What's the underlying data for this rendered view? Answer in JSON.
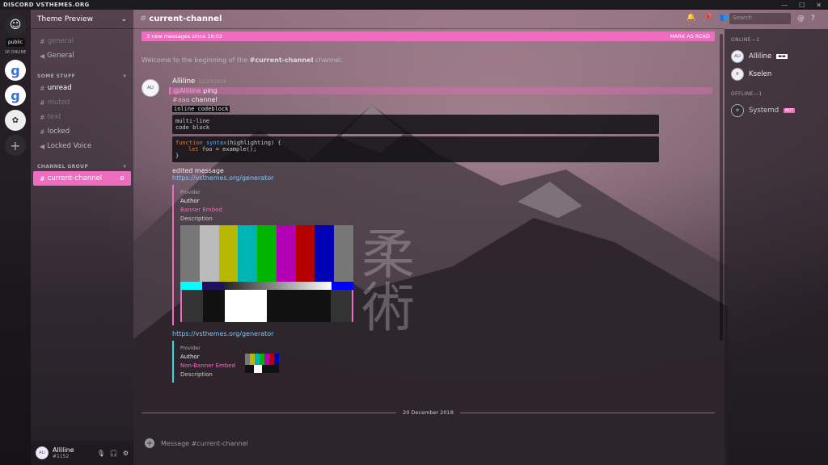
{
  "window": {
    "title": "DISCORD VSTHEMES.ORG",
    "controls": [
      "—",
      "☐",
      "✕"
    ]
  },
  "guilds": {
    "public_label": "public",
    "online_label": "16 ONLINE",
    "add_label": "+"
  },
  "server": {
    "name": "Theme Preview"
  },
  "channels": [
    {
      "name": "general",
      "kind": "text",
      "state": "muted"
    },
    {
      "name": "General",
      "kind": "voice",
      "state": "normal"
    }
  ],
  "categories": [
    {
      "name": "SOME STUFF",
      "channels": [
        {
          "name": "unread",
          "state": "unread"
        },
        {
          "name": "muted",
          "state": "muted"
        },
        {
          "name": "text",
          "state": "muted"
        },
        {
          "name": "locked",
          "state": "normal"
        },
        {
          "name": "Locked Voice",
          "state": "normal"
        }
      ]
    },
    {
      "name": "CHANNEL GROUP",
      "channels": [
        {
          "name": "current-channel",
          "state": "active"
        }
      ]
    }
  ],
  "user": {
    "name": "Alliline",
    "tag": "#1152"
  },
  "chat": {
    "channel": "current-channel",
    "search_placeholder": "Search",
    "new_messages": "3 new messages since 16:02",
    "mark_read": "MARK AS READ",
    "welcome_prefix": "Welcome to the beginning of the ",
    "welcome_channel": "#current-channel",
    "welcome_suffix": " channel.",
    "author": "Alliline",
    "timestamp": "12/20/2018",
    "mention": "@Alliline",
    "mention_text": " ping",
    "channel_link": "#aaa",
    "channel_text": " channel",
    "inline_code": "inline codeblock",
    "codeblock_1": "multi-line\ncode block",
    "code_fn": "function",
    "code_name": "syntax",
    "code_args": "(highlighting) {",
    "code_let": "let",
    "code_rest": " foo = example();",
    "code_close": "}",
    "edited": "edited message",
    "link": "https://vsthemes.org/generator",
    "embed1": {
      "provider": "Provider",
      "author": "Author",
      "title": "Banner Embed",
      "description": "Description"
    },
    "link2": "https://vsthemes.org/generator",
    "embed2": {
      "provider": "Provider",
      "author": "Author",
      "title": "Non-Banner Embed",
      "description": "Description"
    },
    "date_divider": "20 December 2018",
    "composer_placeholder": "Message #current-channel"
  },
  "members": {
    "online_header": "ONLINE—1",
    "online": [
      {
        "name": "Alliline"
      },
      {
        "name": "Kselen"
      }
    ],
    "offline_header": "OFFLINE—1",
    "offline": [
      {
        "name": "Systemd",
        "badge": "BOT"
      }
    ]
  },
  "colors": {
    "accent": "#f06cc0",
    "link": "#7ec8ff"
  }
}
